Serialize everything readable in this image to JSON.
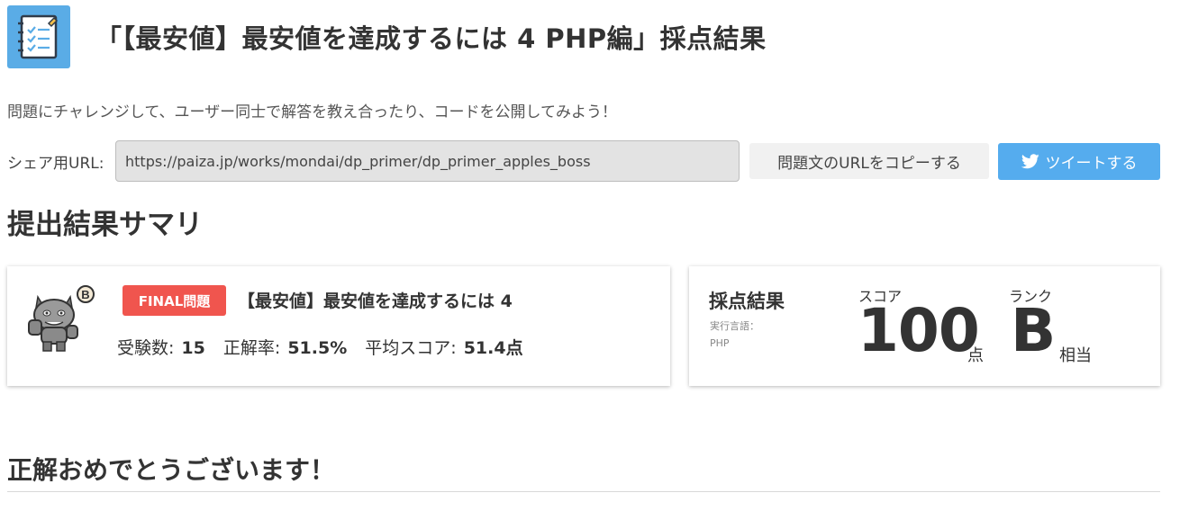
{
  "header": {
    "icon": "checklist-notebook-icon",
    "title": "「【最安値】最安値を達成するには 4 PHP編」採点結果"
  },
  "intro": "問題にチャレンジして、ユーザー同士で解答を教え合ったり、コードを公開してみよう！",
  "share": {
    "label": "シェア用URL:",
    "url": "https://paiza.jp/works/mondai/dp_primer/dp_primer_apples_boss",
    "copy_label": "問題文のURLをコピーする",
    "tweet_label": "ツイートする",
    "tweet_icon": "twitter-bird-icon"
  },
  "summary_heading": "提出結果サマリ",
  "problem": {
    "mascot_icon": "boss-monster-mascot",
    "mascot_rank": "B",
    "badge": "FINAL問題",
    "title": "【最安値】最安値を達成するには 4",
    "stats": {
      "examinees_label": "受験数:",
      "examinees_value": "15",
      "accuracy_label": "正解率:",
      "accuracy_value": "51.5%",
      "average_label": "平均スコア:",
      "average_value": "51.4点"
    }
  },
  "result": {
    "heading": "採点結果",
    "language_label": "実行言語：",
    "language_value": "PHP",
    "score_label": "スコア",
    "score_value": "100",
    "score_unit": "点",
    "rank_label": "ランク",
    "rank_value": "B",
    "rank_unit": "相当"
  },
  "congrats": "正解おめでとうございます！",
  "colors": {
    "accent_blue": "#55acee",
    "final_red": "#f0554e",
    "icon_bg": "#5aace6"
  }
}
